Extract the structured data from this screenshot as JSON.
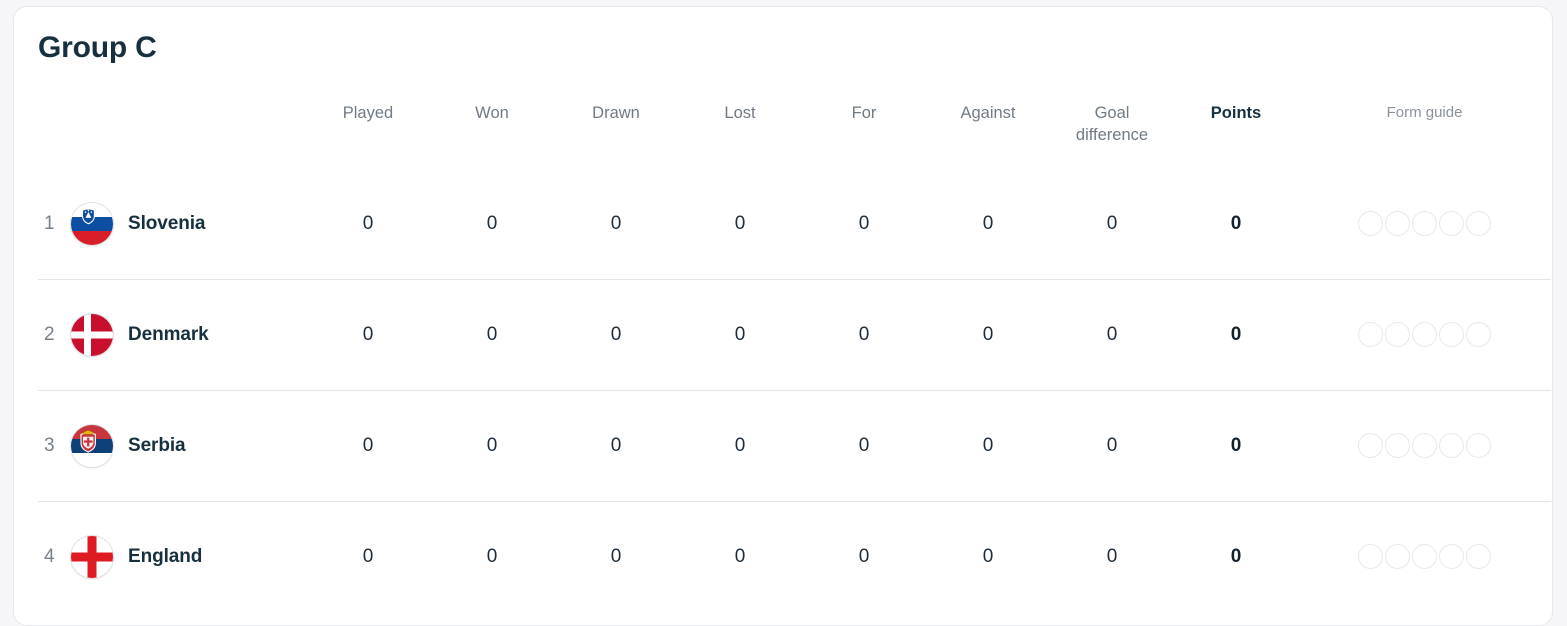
{
  "card": {
    "title": "Group C"
  },
  "table": {
    "headers": {
      "rank": "",
      "team": "",
      "played": "Played",
      "won": "Won",
      "drawn": "Drawn",
      "lost": "Lost",
      "for": "For",
      "against": "Against",
      "goal_difference_line1": "Goal",
      "goal_difference_line2": "difference",
      "points": "Points",
      "form_guide": "Form guide"
    },
    "rows": [
      {
        "rank": "1",
        "team": "Slovenia",
        "flag": "slovenia-flag",
        "played": "0",
        "won": "0",
        "drawn": "0",
        "lost": "0",
        "for": "0",
        "against": "0",
        "goal_difference": "0",
        "points": "0",
        "form": [
          "",
          "",
          "",
          "",
          ""
        ]
      },
      {
        "rank": "2",
        "team": "Denmark",
        "flag": "denmark-flag",
        "played": "0",
        "won": "0",
        "drawn": "0",
        "lost": "0",
        "for": "0",
        "against": "0",
        "goal_difference": "0",
        "points": "0",
        "form": [
          "",
          "",
          "",
          "",
          ""
        ]
      },
      {
        "rank": "3",
        "team": "Serbia",
        "flag": "serbia-flag",
        "played": "0",
        "won": "0",
        "drawn": "0",
        "lost": "0",
        "for": "0",
        "against": "0",
        "goal_difference": "0",
        "points": "0",
        "form": [
          "",
          "",
          "",
          "",
          ""
        ]
      },
      {
        "rank": "4",
        "team": "England",
        "flag": "england-flag",
        "played": "0",
        "won": "0",
        "drawn": "0",
        "lost": "0",
        "for": "0",
        "against": "0",
        "goal_difference": "0",
        "points": "0",
        "form": [
          "",
          "",
          "",
          "",
          ""
        ]
      }
    ]
  },
  "colors": {
    "title": "#17303f",
    "header_text": "#707a86",
    "value_text": "#1f2d3a",
    "row_divider": "#e3e4e9",
    "card_border": "#e6e7ec",
    "page_background": "#f6f6f8",
    "form_dot_border": "#e8e9ee"
  }
}
